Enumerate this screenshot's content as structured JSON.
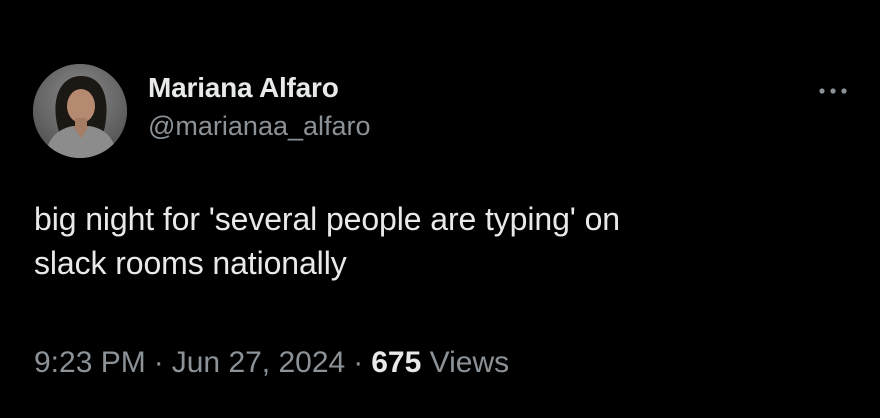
{
  "author": {
    "display_name": "Mariana Alfaro",
    "handle": "@marianaa_alfaro",
    "avatar_icon": "profile-photo"
  },
  "menu": {
    "icon": "more-horizontal-icon"
  },
  "tweet": {
    "line1": "big night for 'several people are typing' on",
    "line2": "slack rooms nationally"
  },
  "meta": {
    "time": "9:23 PM",
    "separator": "·",
    "date": "Jun 27, 2024",
    "views_count": "675",
    "views_label": "Views"
  },
  "colors": {
    "background": "#000000",
    "primary_text": "#e7e9ea",
    "secondary_text": "#8b9298"
  }
}
